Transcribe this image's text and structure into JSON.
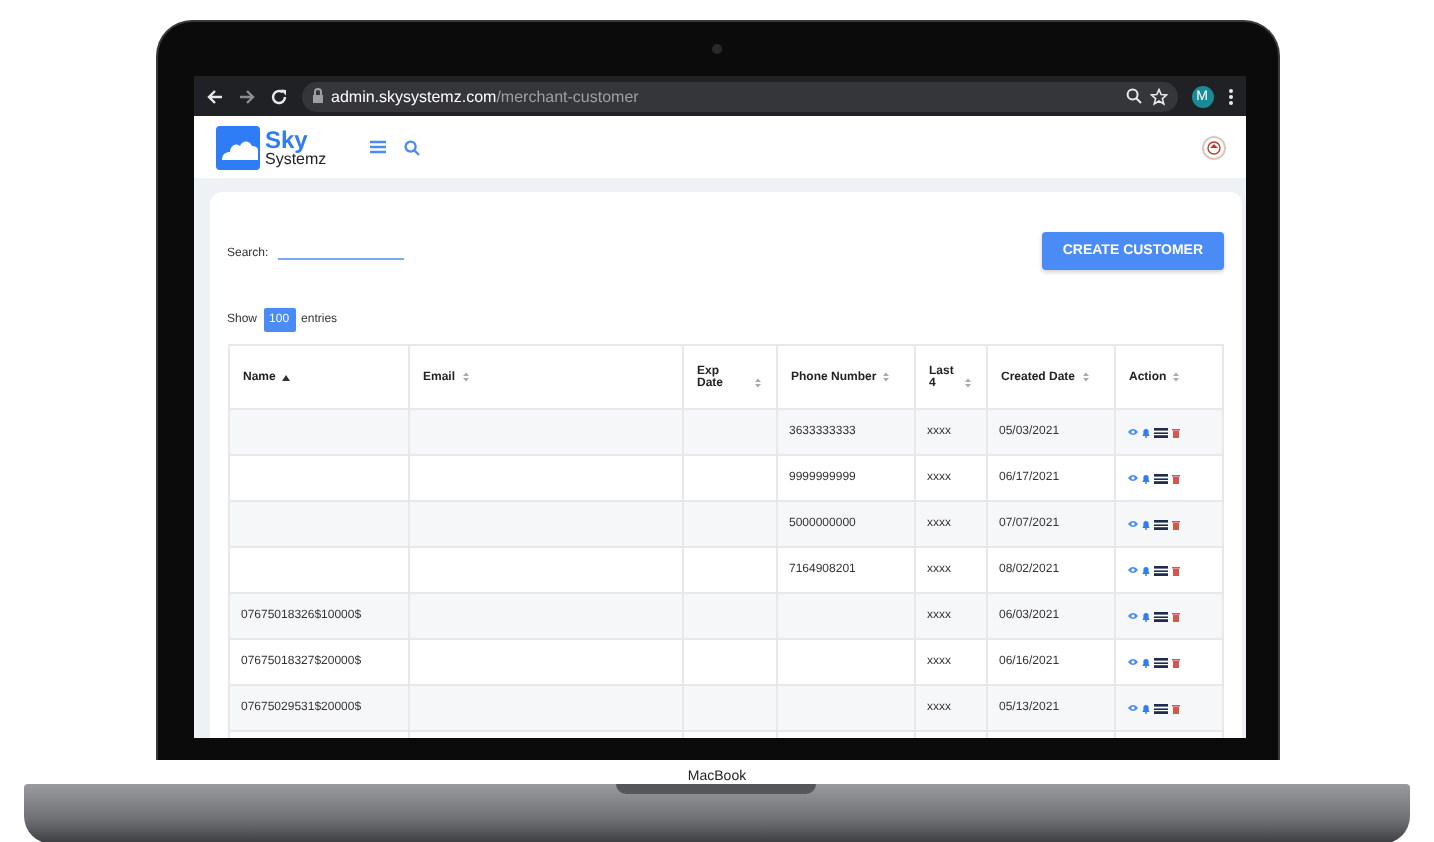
{
  "browser": {
    "url_host": "admin.skysystemz.com",
    "url_path": "/merchant-customer",
    "avatar": "M"
  },
  "app": {
    "logo_top": "Sky",
    "logo_bottom": "Systemz"
  },
  "search": {
    "label": "Search:"
  },
  "create_button": "CREATE CUSTOMER",
  "entries": {
    "before": "Show",
    "value": "100",
    "after": "entries"
  },
  "table": {
    "columns": [
      {
        "label": "Name",
        "sorted": true
      },
      {
        "label": "Email",
        "sorted": false
      },
      {
        "label": "Exp Date",
        "sorted": false
      },
      {
        "label": "Phone Number",
        "sorted": false
      },
      {
        "label": "Last 4",
        "sorted": false
      },
      {
        "label": "Created Date",
        "sorted": false
      },
      {
        "label": "Action",
        "sorted": false
      }
    ],
    "rows": [
      {
        "phone": "3633333333",
        "last4": "xxxx",
        "created": "05/03/2021"
      },
      {
        "phone": "9999999999",
        "last4": "xxxx",
        "created": "06/17/2021"
      },
      {
        "phone": "5000000000",
        "last4": "xxxx",
        "created": "07/07/2021"
      },
      {
        "phone": "7164908201",
        "last4": "xxxx",
        "created": "08/02/2021"
      },
      {
        "name": "07675018326$10000$",
        "last4": "xxxx",
        "created": "06/03/2021"
      },
      {
        "name": "07675018327$20000$",
        "last4": "xxxx",
        "created": "06/16/2021"
      },
      {
        "name": "07675029531$20000$",
        "last4": "xxxx",
        "created": "05/13/2021"
      },
      {}
    ]
  },
  "device": {
    "label": "MacBook"
  }
}
